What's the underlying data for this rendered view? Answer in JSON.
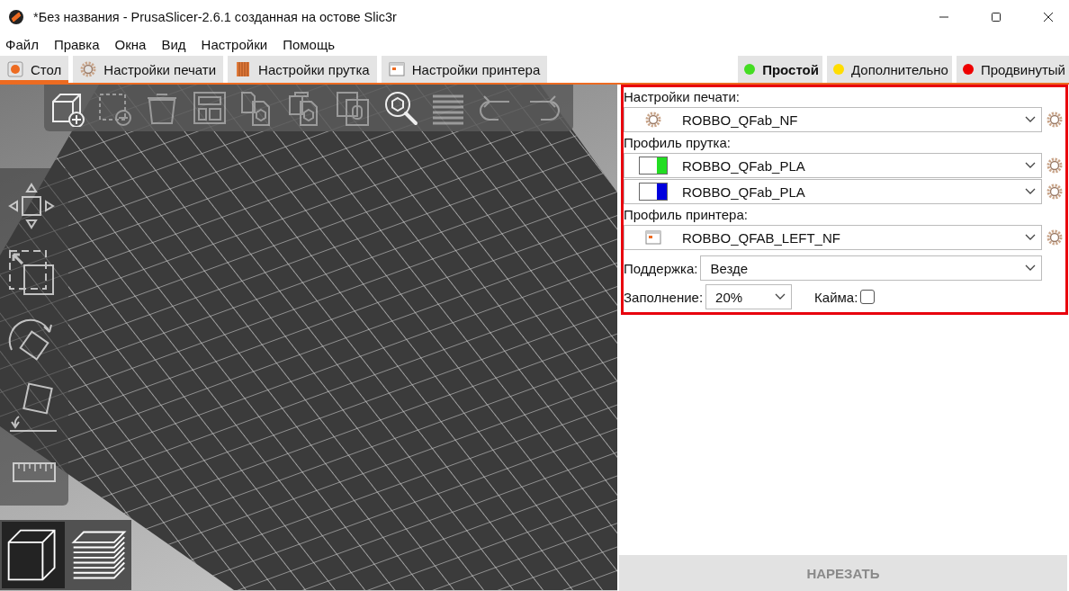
{
  "window": {
    "title": "*Без названия - PrusaSlicer-2.6.1 созданная на остове Slic3r"
  },
  "menu": [
    "Файл",
    "Правка",
    "Окна",
    "Вид",
    "Настройки",
    "Помощь"
  ],
  "tabs": [
    {
      "label": "Стол",
      "kind": "plater",
      "selected": true
    },
    {
      "label": "Настройки печати",
      "kind": "print",
      "selected": false
    },
    {
      "label": "Настройки прутка",
      "kind": "filament",
      "selected": false
    },
    {
      "label": "Настройки принтера",
      "kind": "printer",
      "selected": false
    }
  ],
  "modes": [
    {
      "label": "Простой",
      "color": "#44dd22",
      "selected": true
    },
    {
      "label": "Дополнительно",
      "color": "#ffdd00",
      "selected": false
    },
    {
      "label": "Продвинутый",
      "color": "#ee0000",
      "selected": false
    }
  ],
  "toolbar": [
    {
      "kind": "add",
      "disabled": false
    },
    {
      "kind": "delete",
      "disabled": true
    },
    {
      "kind": "delete_all",
      "disabled": true
    },
    {
      "kind": "arrange",
      "disabled": true
    },
    {
      "kind": "copy",
      "disabled": true
    },
    {
      "kind": "paste",
      "disabled": true
    },
    {
      "kind": "split",
      "disabled": true
    },
    {
      "kind": "search",
      "disabled": false
    },
    {
      "kind": "layers",
      "disabled": true
    },
    {
      "kind": "undo",
      "disabled": true
    },
    {
      "kind": "redo",
      "disabled": true
    }
  ],
  "gizmos": [
    {
      "kind": "move"
    },
    {
      "kind": "scale"
    },
    {
      "kind": "rotate"
    },
    {
      "kind": "place"
    },
    {
      "kind": "measure"
    }
  ],
  "views": [
    {
      "kind": "model",
      "selected": true
    },
    {
      "kind": "preview",
      "selected": false
    }
  ],
  "panel": {
    "print": {
      "label": "Настройки печати:",
      "value": "ROBBO_QFab_NF"
    },
    "filament": {
      "label": "Профиль прутка:",
      "extruders": [
        {
          "value": "ROBBO_QFab_PLA",
          "color": "#22dd22"
        },
        {
          "value": "ROBBO_QFab_PLA",
          "color": "#0000dd"
        }
      ]
    },
    "printer": {
      "label": "Профиль принтера:",
      "value": "ROBBO_QFAB_LEFT_NF"
    },
    "support": {
      "label": "Поддержка:",
      "value": "Везде"
    },
    "infill": {
      "label": "Заполнение:",
      "value": "20%"
    },
    "brim": {
      "label": "Кайма:",
      "checked": false
    }
  },
  "slice_button": {
    "label": "НАРЕЗАТЬ",
    "disabled": true
  }
}
